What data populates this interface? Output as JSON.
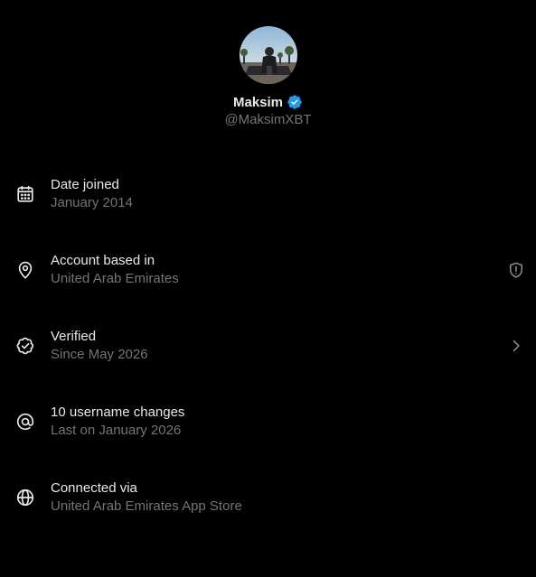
{
  "profile": {
    "display_name": "Maksim",
    "handle": "@MaksimXBT",
    "verified_badge_icon": "verified-badge-icon",
    "badge_color": "#1d9bf0"
  },
  "colors": {
    "background": "#000000",
    "primary_text": "#e7e9ea",
    "secondary_text": "#71767b"
  },
  "rows": [
    {
      "icon": "calendar-icon",
      "title": "Date joined",
      "subtitle": "January 2014"
    },
    {
      "icon": "location-pin-icon",
      "title": "Account based in",
      "subtitle": "United Arab Emirates",
      "trailing_icon": "shield-alert-icon"
    },
    {
      "icon": "verified-check-icon",
      "title": "Verified",
      "subtitle": "Since May 2026",
      "trailing_icon": "chevron-right-icon"
    },
    {
      "icon": "at-sign-icon",
      "title": "10 username changes",
      "subtitle": "Last on January 2026"
    },
    {
      "icon": "globe-icon",
      "title": "Connected via",
      "subtitle": "United Arab Emirates App Store"
    }
  ]
}
